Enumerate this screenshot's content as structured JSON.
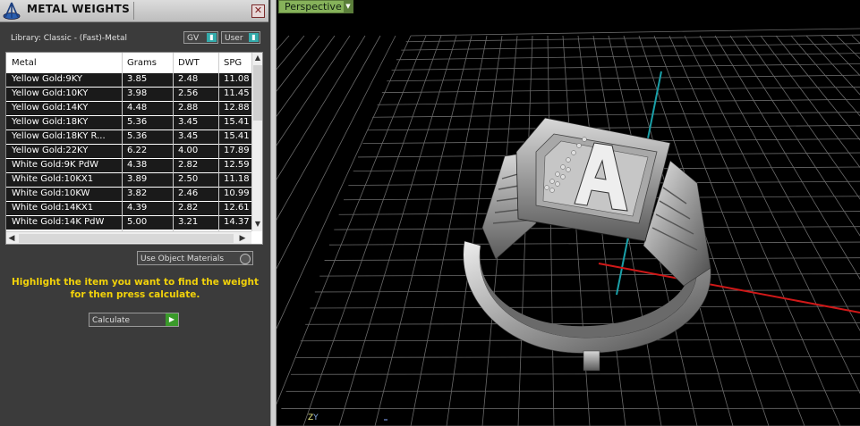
{
  "panel": {
    "title": "METAL WEIGHTS",
    "close_glyph": "✕",
    "library_label": "Library: Classic - (Fast)-Metal",
    "gv_label": "GV",
    "user_label": "User",
    "use_object_materials": "Use Object Materials",
    "hint": "Highlight the item you want to find the weight for then press calculate.",
    "calculate_label": "Calculate",
    "logo_icon": "tripod-logo-icon",
    "accent": "#f2d20a"
  },
  "table": {
    "columns": [
      "Metal",
      "Grams",
      "DWT",
      "SPG"
    ],
    "rows": [
      [
        "Yellow Gold:9KY",
        "3.85",
        "2.48",
        "11.08"
      ],
      [
        "Yellow Gold:10KY",
        "3.98",
        "2.56",
        "11.45"
      ],
      [
        "Yellow Gold:14KY",
        "4.48",
        "2.88",
        "12.88"
      ],
      [
        "Yellow Gold:18KY",
        "5.36",
        "3.45",
        "15.41"
      ],
      [
        "Yellow Gold:18KY R...",
        "5.36",
        "3.45",
        "15.41"
      ],
      [
        "Yellow Gold:22KY",
        "6.22",
        "4.00",
        "17.89"
      ],
      [
        "White Gold:9K PdW",
        "4.38",
        "2.82",
        "12.59"
      ],
      [
        "White Gold:10KX1",
        "3.89",
        "2.50",
        "11.18"
      ],
      [
        "White Gold:10KW",
        "3.82",
        "2.46",
        "10.99"
      ],
      [
        "White Gold:14KX1",
        "4.39",
        "2.82",
        "12.61"
      ],
      [
        "White Gold:14K PdW",
        "5.00",
        "3.21",
        "14.37"
      ]
    ]
  },
  "viewport": {
    "view_label": "Perspective",
    "axis_z": "Z",
    "axis_y": "Y",
    "axis_x_color": "#d01818",
    "axis_y_color": "#1aa0a8",
    "grid_color": "#6a6a6a"
  }
}
